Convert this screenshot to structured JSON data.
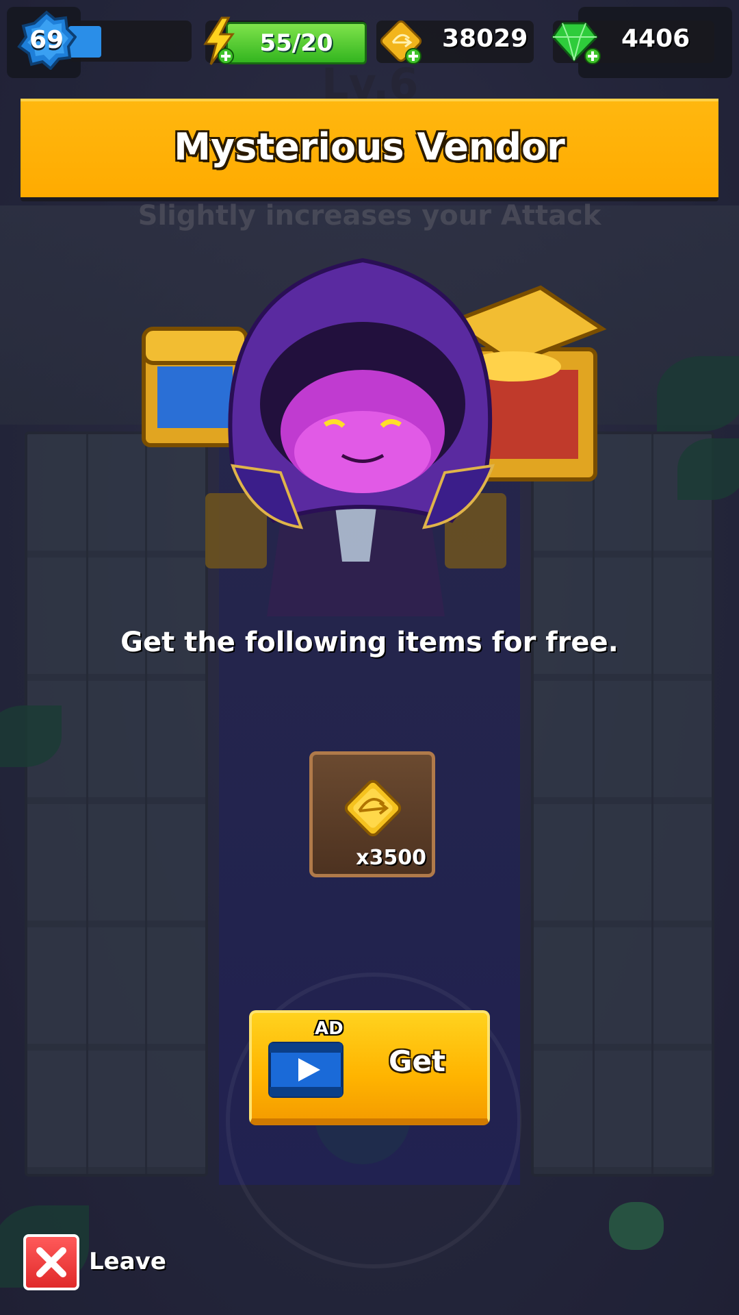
{
  "hud": {
    "level": "69",
    "energy": "55/20",
    "gold": "38029",
    "gems": "4406"
  },
  "popup": {
    "title": "Mysterious Vendor",
    "message": "Get  the following items for free.",
    "reward": {
      "icon": "gold-coin-icon",
      "quantity": "x3500"
    },
    "get_button": {
      "ad_badge": "AD",
      "label": "Get"
    }
  },
  "background": {
    "level_text": "Lv.6",
    "skill_text": "Slightly increases your Attack"
  },
  "leave": {
    "label": "Leave"
  },
  "colors": {
    "banner": "#ffab00",
    "button": "#ffb400",
    "energy": "#33b51f",
    "gem": "#2ecc3b",
    "leave": "#e02a2a"
  }
}
